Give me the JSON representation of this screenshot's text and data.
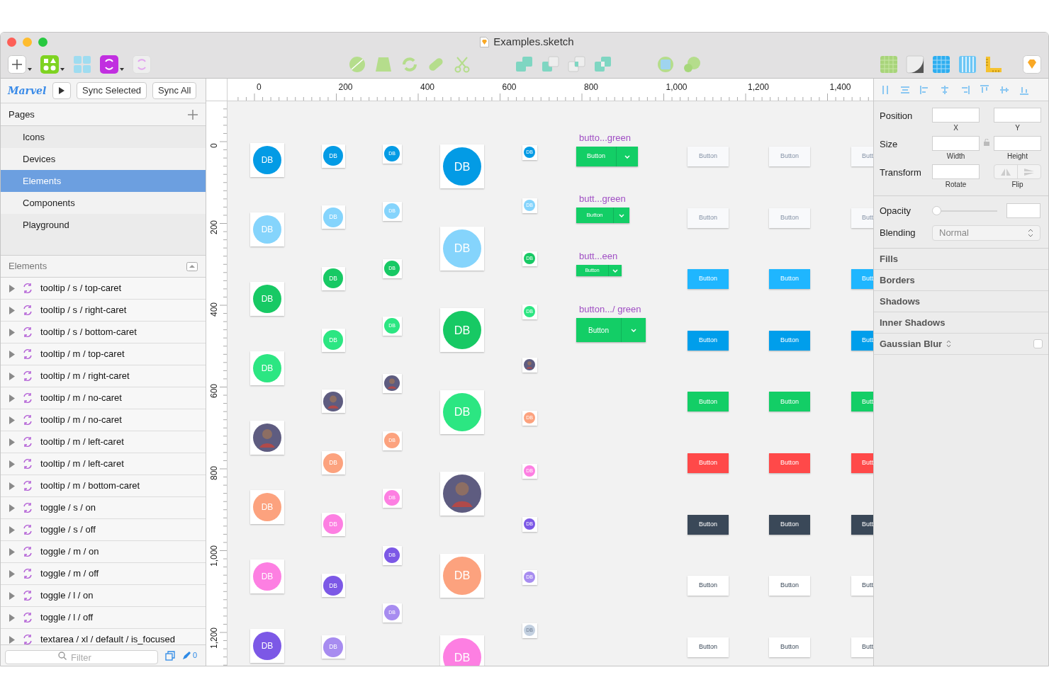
{
  "window": {
    "title": "Examples.sketch"
  },
  "marvel": {
    "logo": "Marvel",
    "buttons": [
      "Sync Selected",
      "Sync All"
    ]
  },
  "pages": {
    "title": "Pages",
    "items": [
      {
        "label": "Icons",
        "selected": false
      },
      {
        "label": "Devices",
        "selected": false
      },
      {
        "label": "Elements",
        "selected": true
      },
      {
        "label": "Components",
        "selected": false
      },
      {
        "label": "Playground",
        "selected": false
      }
    ]
  },
  "layers": {
    "title": "Elements",
    "items": [
      "tooltip / s / top-caret",
      "tooltip / s / right-caret",
      "tooltip / s / bottom-caret",
      "tooltip / m / top-caret",
      "tooltip / m / right-caret",
      "tooltip / m / no-caret",
      "tooltip / m / no-caret",
      "tooltip / m / left-caret",
      "tooltip / m / left-caret",
      "tooltip / m / bottom-caret",
      "toggle / s / on",
      "toggle / s / off",
      "toggle / m / on",
      "toggle / m / off",
      "toggle / l / on",
      "toggle / l / off",
      "textarea / xl / default / is_focused"
    ]
  },
  "filter": {
    "placeholder": "Filter",
    "count": "0"
  },
  "rulers": {
    "horizontal": [
      "0",
      "200",
      "400",
      "600",
      "800",
      "1,000",
      "1,200",
      "1,400"
    ],
    "vertical": [
      "0",
      "200",
      "400",
      "600",
      "800",
      "1,000",
      "1,200"
    ]
  },
  "canvas": {
    "avatar_columns": [
      {
        "items": [
          {
            "kind": "initials",
            "text": "DB",
            "color": "#039be5"
          },
          {
            "kind": "initials",
            "text": "DB",
            "color": "#85d4fc"
          },
          {
            "kind": "initials",
            "text": "DB",
            "color": "#17c964"
          },
          {
            "kind": "initials",
            "text": "DB",
            "color": "#2ce682"
          },
          {
            "kind": "photo"
          },
          {
            "kind": "initials",
            "text": "DB",
            "color": "#fca27e"
          },
          {
            "kind": "initials",
            "text": "DB",
            "color": "#fd7fe2"
          },
          {
            "kind": "initials",
            "text": "DB",
            "color": "#7c58e6"
          }
        ]
      },
      {
        "items": [
          {
            "kind": "initials",
            "text": "DB",
            "color": "#039be5"
          },
          {
            "kind": "initials",
            "text": "DB",
            "color": "#85d4fc"
          },
          {
            "kind": "initials",
            "text": "DB",
            "color": "#17c964"
          },
          {
            "kind": "initials",
            "text": "DB",
            "color": "#2ce682"
          },
          {
            "kind": "photo"
          },
          {
            "kind": "initials",
            "text": "DB",
            "color": "#fca27e"
          },
          {
            "kind": "initials",
            "text": "DB",
            "color": "#fd7fe2"
          },
          {
            "kind": "initials",
            "text": "DB",
            "color": "#7c58e6"
          },
          {
            "kind": "initials",
            "text": "DB",
            "color": "#a78cf0"
          }
        ]
      },
      {
        "items": [
          {
            "kind": "initials",
            "text": "DB",
            "color": "#039be5"
          },
          {
            "kind": "initials",
            "text": "DB",
            "color": "#85d4fc"
          },
          {
            "kind": "initials",
            "text": "DB",
            "color": "#17c964"
          },
          {
            "kind": "initials",
            "text": "DB",
            "color": "#2ce682"
          },
          {
            "kind": "photo"
          },
          {
            "kind": "initials",
            "text": "DB",
            "color": "#fca27e"
          },
          {
            "kind": "initials",
            "text": "DB",
            "color": "#fd7fe2"
          },
          {
            "kind": "initials",
            "text": "DB",
            "color": "#7c58e6"
          },
          {
            "kind": "initials",
            "text": "DB",
            "color": "#a78cf0"
          }
        ]
      },
      {
        "items": [
          {
            "kind": "initials",
            "text": "DB",
            "color": "#039be5"
          },
          {
            "kind": "initials",
            "text": "DB",
            "color": "#85d4fc"
          },
          {
            "kind": "initials",
            "text": "DB",
            "color": "#17c964"
          },
          {
            "kind": "initials",
            "text": "DB",
            "color": "#2ce682"
          },
          {
            "kind": "photo"
          },
          {
            "kind": "initials",
            "text": "DB",
            "color": "#fca27e"
          },
          {
            "kind": "initials",
            "text": "DB",
            "color": "#fd7fe2"
          }
        ]
      },
      {
        "items": [
          {
            "kind": "initials",
            "text": "DB",
            "color": "#039be5"
          },
          {
            "kind": "initials",
            "text": "DB",
            "color": "#85d4fc"
          },
          {
            "kind": "initials",
            "text": "DB",
            "color": "#17c964"
          },
          {
            "kind": "initials",
            "text": "DB",
            "color": "#2ce682"
          },
          {
            "kind": "photo"
          },
          {
            "kind": "initials",
            "text": "DB",
            "color": "#fca27e"
          },
          {
            "kind": "initials",
            "text": "DB",
            "color": "#fd7fe2"
          },
          {
            "kind": "initials",
            "text": "DB",
            "color": "#7c58e6"
          },
          {
            "kind": "initials",
            "text": "DB",
            "color": "#a78cf0"
          },
          {
            "kind": "initials",
            "text": "DB",
            "color": "#c3d0e0"
          }
        ]
      }
    ],
    "split_buttons": [
      {
        "label": "butto...green",
        "text": "Button",
        "kind": "medium"
      },
      {
        "label": "butt...green",
        "text": "Button",
        "kind": "small"
      },
      {
        "label": "butt...een",
        "text": "Button",
        "kind": "tiny"
      },
      {
        "label": "button.../ green",
        "text": "Button",
        "kind": "large"
      }
    ],
    "button_grid": [
      {
        "kind": "light",
        "labels": [
          "Button",
          "Button",
          "Butt"
        ]
      },
      {
        "kind": "light",
        "labels": [
          "Button",
          "Button",
          "Butt"
        ]
      },
      {
        "kind": "cyan",
        "labels": [
          "Button",
          "Button",
          "Butt"
        ]
      },
      {
        "kind": "blue",
        "labels": [
          "Button",
          "Button",
          "Butt"
        ]
      },
      {
        "kind": "green",
        "labels": [
          "Button",
          "Button",
          "Butt"
        ]
      },
      {
        "kind": "red",
        "labels": [
          "Button",
          "Button",
          "Butt"
        ]
      },
      {
        "kind": "dark",
        "labels": [
          "Button",
          "Button",
          "Butt"
        ]
      },
      {
        "kind": "white",
        "labels": [
          "Button",
          "Button",
          "Butt"
        ]
      },
      {
        "kind": "white",
        "labels": [
          "Button",
          "Button",
          "Butt"
        ]
      }
    ]
  },
  "inspector": {
    "rows": [
      {
        "label": "Position",
        "kind": "pair",
        "fields": [
          "X",
          "Y"
        ]
      },
      {
        "label": "Size",
        "kind": "locked",
        "fields": [
          "Width",
          "Height"
        ]
      },
      {
        "label": "Transform",
        "kind": "transform",
        "fields": [
          "Rotate",
          "Flip"
        ]
      }
    ],
    "opacity": {
      "label": "Opacity",
      "level": 0
    },
    "blending": {
      "label": "Blending",
      "value": "Normal"
    },
    "sections": [
      {
        "label": "Fills",
        "kind": "plain"
      },
      {
        "label": "Borders",
        "kind": "plain"
      },
      {
        "label": "Shadows",
        "kind": "plain"
      },
      {
        "label": "Inner Shadows",
        "kind": "plain"
      },
      {
        "label": "Gaussian Blur",
        "kind": "toggle",
        "checked": false
      }
    ]
  }
}
